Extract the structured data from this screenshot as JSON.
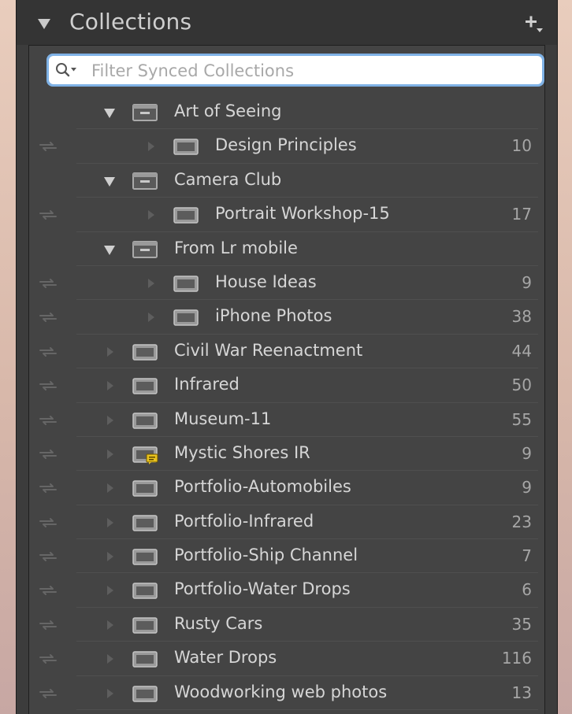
{
  "panel": {
    "title": "Collections",
    "add_icon": "plus-with-dropdown-icon",
    "collapse_icon": "triangle-down-icon"
  },
  "search": {
    "placeholder": "Filter Synced Collections",
    "value": "",
    "icon": "search-icon"
  },
  "colors": {
    "panel_bg": "#3c3c3c",
    "list_bg": "#444444",
    "text": "#d6d6d6",
    "count_text": "#a6a6a6",
    "focus_ring": "#7fb2e6",
    "badge": "#e8c21e"
  },
  "items": [
    {
      "label": "Art of Seeing",
      "count": "",
      "level": 0,
      "kind": "set",
      "expanded": true,
      "synced": false
    },
    {
      "label": "Design Principles",
      "count": "10",
      "level": 1,
      "kind": "collection",
      "synced": true
    },
    {
      "label": "Camera Club",
      "count": "",
      "level": 0,
      "kind": "set",
      "expanded": true,
      "synced": false
    },
    {
      "label": "Portrait Workshop-15",
      "count": "17",
      "level": 1,
      "kind": "collection",
      "synced": true
    },
    {
      "label": "From Lr mobile",
      "count": "",
      "level": 0,
      "kind": "set",
      "expanded": true,
      "synced": false
    },
    {
      "label": "House Ideas",
      "count": "9",
      "level": 1,
      "kind": "collection",
      "synced": true
    },
    {
      "label": "iPhone Photos",
      "count": "38",
      "level": 1,
      "kind": "collection",
      "synced": true
    },
    {
      "label": "Civil War Reenactment",
      "count": "44",
      "level": 0,
      "kind": "collection",
      "synced": true
    },
    {
      "label": "Infrared",
      "count": "50",
      "level": 0,
      "kind": "collection",
      "synced": true
    },
    {
      "label": "Museum-11",
      "count": "55",
      "level": 0,
      "kind": "collection",
      "synced": true
    },
    {
      "label": "Mystic Shores IR",
      "count": "9",
      "level": 0,
      "kind": "collection-commented",
      "synced": true
    },
    {
      "label": "Portfolio-Automobiles",
      "count": "9",
      "level": 0,
      "kind": "collection",
      "synced": true
    },
    {
      "label": "Portfolio-Infrared",
      "count": "23",
      "level": 0,
      "kind": "collection",
      "synced": true
    },
    {
      "label": "Portfolio-Ship Channel",
      "count": "7",
      "level": 0,
      "kind": "collection",
      "synced": true
    },
    {
      "label": "Portfolio-Water Drops",
      "count": "6",
      "level": 0,
      "kind": "collection",
      "synced": true
    },
    {
      "label": "Rusty Cars",
      "count": "35",
      "level": 0,
      "kind": "collection",
      "synced": true
    },
    {
      "label": "Water Drops",
      "count": "116",
      "level": 0,
      "kind": "collection",
      "synced": true
    },
    {
      "label": "Woodworking web photos",
      "count": "13",
      "level": 0,
      "kind": "collection",
      "synced": true
    }
  ]
}
